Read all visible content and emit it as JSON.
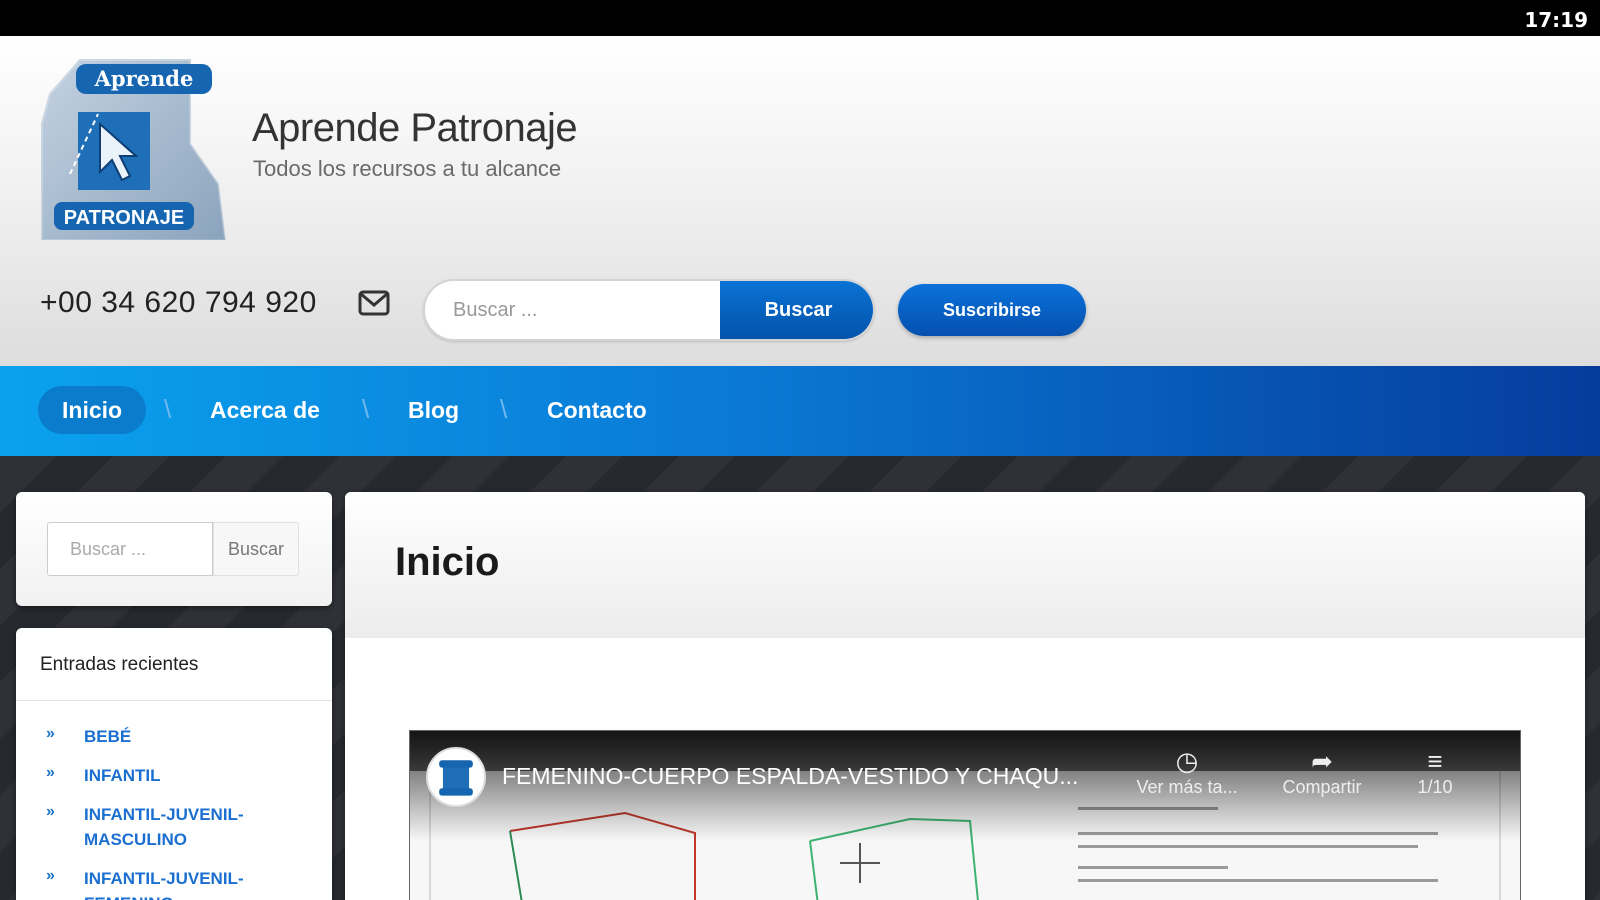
{
  "status_bar": {
    "time": "17:19"
  },
  "header": {
    "logo": {
      "top_text": "Aprende",
      "bottom_text": "PATRONAJE"
    },
    "site_title": "Aprende Patronaje",
    "tagline": "Todos los recursos a tu alcance",
    "phone": "+00 34 620 794 920",
    "search": {
      "placeholder": "Buscar ...",
      "button_label": "Buscar"
    },
    "subscribe_label": "Suscribirse"
  },
  "nav": {
    "items": [
      {
        "label": "Inicio",
        "active": true
      },
      {
        "label": "Acerca de",
        "active": false
      },
      {
        "label": "Blog",
        "active": false
      },
      {
        "label": "Contacto",
        "active": false
      }
    ]
  },
  "sidebar": {
    "search": {
      "placeholder": "Buscar ...",
      "button_label": "Buscar"
    },
    "recent": {
      "title": "Entradas recientes",
      "items": [
        {
          "label": "BEBÉ"
        },
        {
          "label": "INFANTIL"
        },
        {
          "label": "INFANTIL-JUVENIL-MASCULINO"
        },
        {
          "label": "INFANTIL-JUVENIL-FEMENINO"
        }
      ]
    }
  },
  "main": {
    "page_title": "Inicio",
    "video": {
      "title": "FEMENINO-CUERPO ESPALDA-VESTIDO Y CHAQU...",
      "watch_later": "Ver más ta...",
      "share": "Compartir",
      "playlist_count": "1/10"
    }
  },
  "colors": {
    "nav_start": "#0aa2ee",
    "nav_end": "#053c9c",
    "button_blue": "#0252a8",
    "link_blue": "#1a6fd0"
  }
}
